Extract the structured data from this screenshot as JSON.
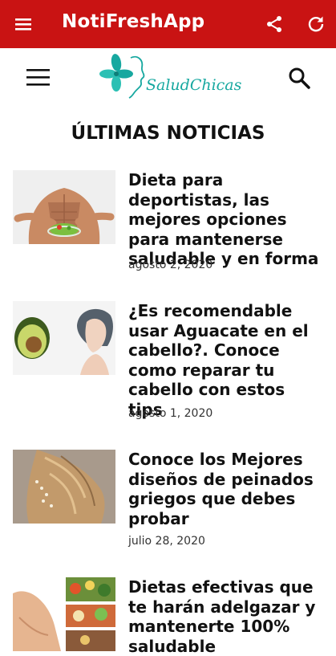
{
  "appbar": {
    "title": "NotiFreshApp",
    "color": "#c91313",
    "icons": [
      "menu-icon",
      "share-icon",
      "refresh-icon"
    ]
  },
  "site": {
    "logo_text": "SaludChicas",
    "logo_color": "#17a8a0"
  },
  "heading": "ÚLTIMAS NOTICIAS",
  "articles": [
    {
      "title": "Dieta para deportistas, las mejores opciones para mantenerse saludable y en forma",
      "date": "agosto 2, 2020"
    },
    {
      "title": "¿Es recomendable usar Aguacate en el cabello?. Conoce como reparar tu cabello con estos tips",
      "date": "agosto 1, 2020"
    },
    {
      "title": "Conoce los Mejores diseños de peinados griegos que debes probar",
      "date": "julio 28, 2020"
    },
    {
      "title": "Dietas efectivas que te harán adelgazar y mantenerte 100% saludable",
      "date": ""
    }
  ]
}
